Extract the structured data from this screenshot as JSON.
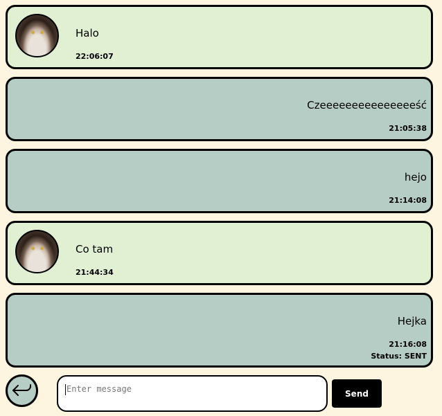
{
  "messages": [
    {
      "text": "Halo",
      "time": "22:06:07"
    },
    {
      "text": "Czeeeeeeeeeeeeeeeść",
      "time": "21:05:38"
    },
    {
      "text": "hejo",
      "time": "21:14:08"
    },
    {
      "text": "Co tam",
      "time": "21:44:34"
    },
    {
      "text": "Hejka",
      "time": "21:16:08",
      "status": "Status: SENT"
    }
  ],
  "composer": {
    "placeholder": "Enter message",
    "value": "",
    "send_label": "Send"
  },
  "colors": {
    "background": "#fdf5e0",
    "incoming": "#e1efd3",
    "outgoing": "#b6cdc6",
    "border": "#000000"
  }
}
